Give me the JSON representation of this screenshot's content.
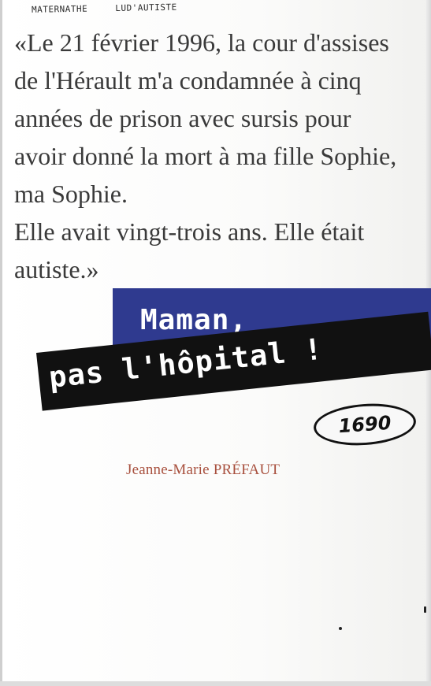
{
  "handwritten_note": [
    "MATERNATHE",
    "LUD'AUTISTE"
  ],
  "quote_lines": [
    "«Le 21 février 1996, la cour d'assises",
    "de l'Hérault m'a condamnée à cinq",
    "années de prison avec sursis pour",
    "avoir donné la mort à ma fille Sophie,",
    "ma Sophie.",
    "Elle avait vingt-trois ans. Elle était",
    "autiste.»"
  ],
  "title": {
    "line1": "Maman,",
    "line2": "pas l'hôpital !"
  },
  "stamp_number": "1690",
  "author": "Jeanne-Marie PRÉFAUT",
  "colors": {
    "blue_band": "#2f3a8f",
    "black_band": "#111111",
    "author_text": "#a8503e",
    "quote_text": "#3a3a3a"
  }
}
